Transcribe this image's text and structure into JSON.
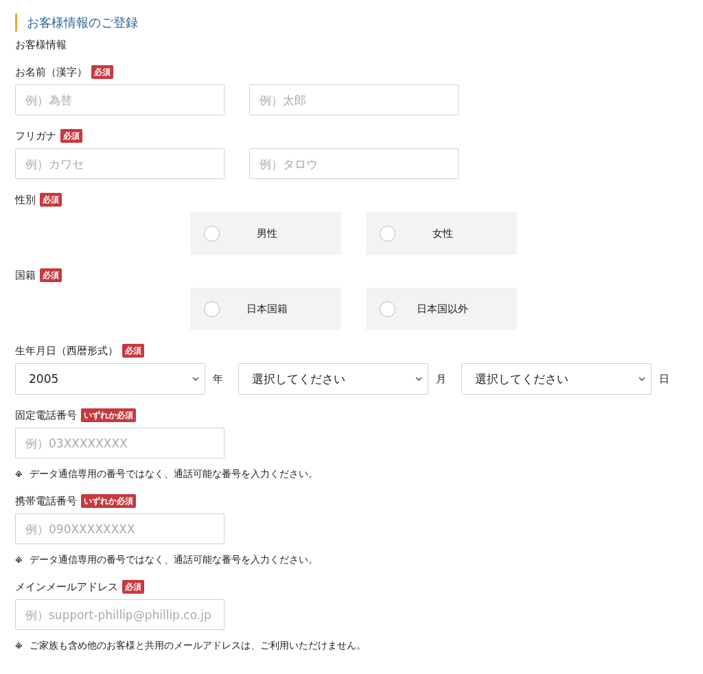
{
  "title": "お客様情報のご登録",
  "section_label": "お客様情報",
  "fields": [
    {
      "kind": "text_pair",
      "label": "お名前（漢字）",
      "badge": "必須",
      "placeholders": [
        "例）為替",
        "例）太郎"
      ]
    },
    {
      "kind": "text_pair",
      "label": "フリガナ",
      "badge": "必須",
      "placeholders": [
        "例）カワセ",
        "例）タロウ"
      ]
    },
    {
      "kind": "radio",
      "label": "性別",
      "badge": "必須",
      "options": [
        {
          "label": "男性",
          "selected": false
        },
        {
          "label": "女性",
          "selected": false
        }
      ]
    },
    {
      "kind": "radio",
      "label": "国籍",
      "badge": "必須",
      "options": [
        {
          "label": "日本国籍",
          "selected": false
        },
        {
          "label": "日本国以外",
          "selected": false
        }
      ]
    },
    {
      "kind": "date",
      "label": "生年月日（西暦形式）",
      "badge": "必須",
      "selects": [
        {
          "value": "2005",
          "unit": "年"
        },
        {
          "value": "選択してください",
          "unit": "月"
        },
        {
          "value": "選択してください",
          "unit": "日"
        }
      ]
    },
    {
      "kind": "text",
      "label": "固定電話番号",
      "badge": "いずれか必須",
      "placeholder": "例）03XXXXXXXX",
      "note": {
        "mark": "※",
        "text": "データ通信専用の番号ではなく、通話可能な番号を入力ください。"
      }
    },
    {
      "kind": "text",
      "label": "携帯電話番号",
      "badge": "いずれか必須",
      "placeholder": "例）090XXXXXXXX",
      "note": {
        "mark": "※",
        "text": "データ通信専用の番号ではなく、通話可能な番号を入力ください。"
      }
    },
    {
      "kind": "text",
      "label": "メインメールアドレス",
      "badge": "必須",
      "placeholder": "例）support-phillip@phillip.co.jp",
      "note": {
        "mark": "※",
        "text": "ご家族も含め他のお客様と共用のメールアドレスは、ご利用いただけません。"
      }
    }
  ]
}
